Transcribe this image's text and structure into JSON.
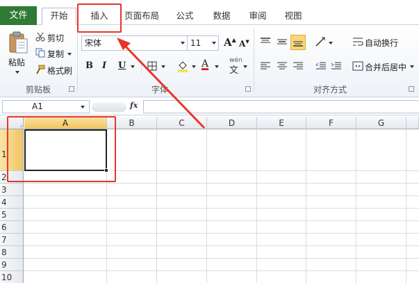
{
  "tabs": {
    "file": "文件",
    "home": "开始",
    "insert": "插入",
    "page_layout": "页面布局",
    "formulas": "公式",
    "data": "数据",
    "review": "审阅",
    "view": "视图"
  },
  "clipboard": {
    "paste": "粘贴",
    "cut": "剪切",
    "copy": "复制",
    "format_painter": "格式刷",
    "group_label": "剪贴板"
  },
  "font": {
    "name": "宋体",
    "size": "11",
    "group_label": "字体",
    "phonetic": "wén",
    "bold": "B",
    "italic": "I",
    "underline": "U",
    "font_color_letter": "A",
    "grow_letter": "A",
    "shrink_letter": "A"
  },
  "alignment": {
    "wrap_text": "自动换行",
    "merge_center": "合并后居中",
    "group_label": "对齐方式"
  },
  "formula_bar": {
    "name_box": "A1",
    "fx": "fx",
    "value": ""
  },
  "sheet": {
    "columns": [
      "A",
      "B",
      "C",
      "D",
      "E",
      "F",
      "G"
    ],
    "rows": [
      "1",
      "2",
      "3",
      "4",
      "5",
      "6",
      "7",
      "8",
      "9",
      "10"
    ],
    "selected_cell": "A1"
  },
  "colors": {
    "file_tab": "#2f7a35",
    "selection_header": "#f1c460",
    "annotation": "#e8352a"
  }
}
